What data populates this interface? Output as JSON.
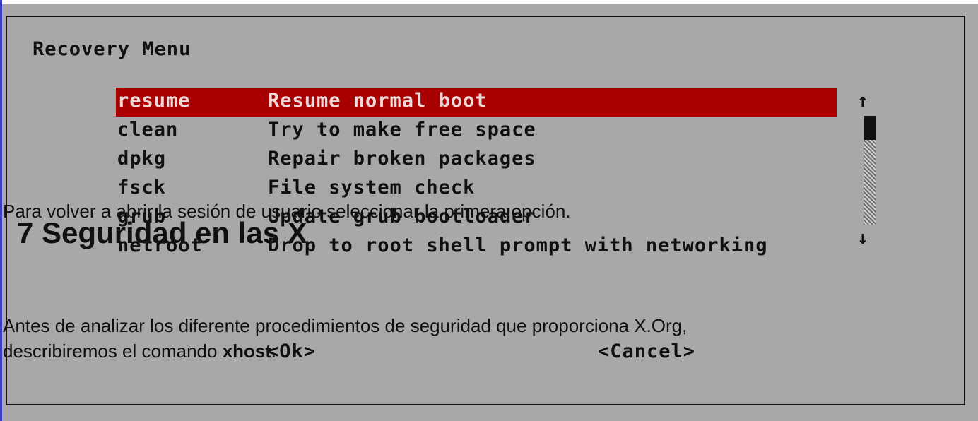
{
  "dialog": {
    "title": "Recovery Menu",
    "items": [
      {
        "key": "resume",
        "desc": "Resume normal boot"
      },
      {
        "key": "clean",
        "desc": "Try to make free space"
      },
      {
        "key": "dpkg",
        "desc": "Repair broken packages"
      },
      {
        "key": "fsck",
        "desc": "File system check"
      },
      {
        "key": "grub",
        "desc": "Update grub bootloader"
      },
      {
        "key": "netroot",
        "desc": "Drop to root shell prompt with networking"
      }
    ],
    "selected_index": 0,
    "scroll_up_glyph": "↑",
    "scroll_down_glyph": "↓",
    "ok_label": "<Ok>",
    "cancel_label": "<Cancel>"
  },
  "overlay": {
    "line1": "Para volver a abrir la sesión de usuario seleccionar la primera opción.",
    "heading": "7 Seguridad en las X",
    "line2": "Antes de analizar los diferente procedimientos de seguridad que proporciona X.Org,",
    "line3_prefix": "describiremos el comando ",
    "line3_cmd": "xhost",
    "line3_suffix": "."
  },
  "colors": {
    "screen_bg": "#a8a8a8",
    "selection_bg": "#a80000",
    "text": "#101010"
  }
}
